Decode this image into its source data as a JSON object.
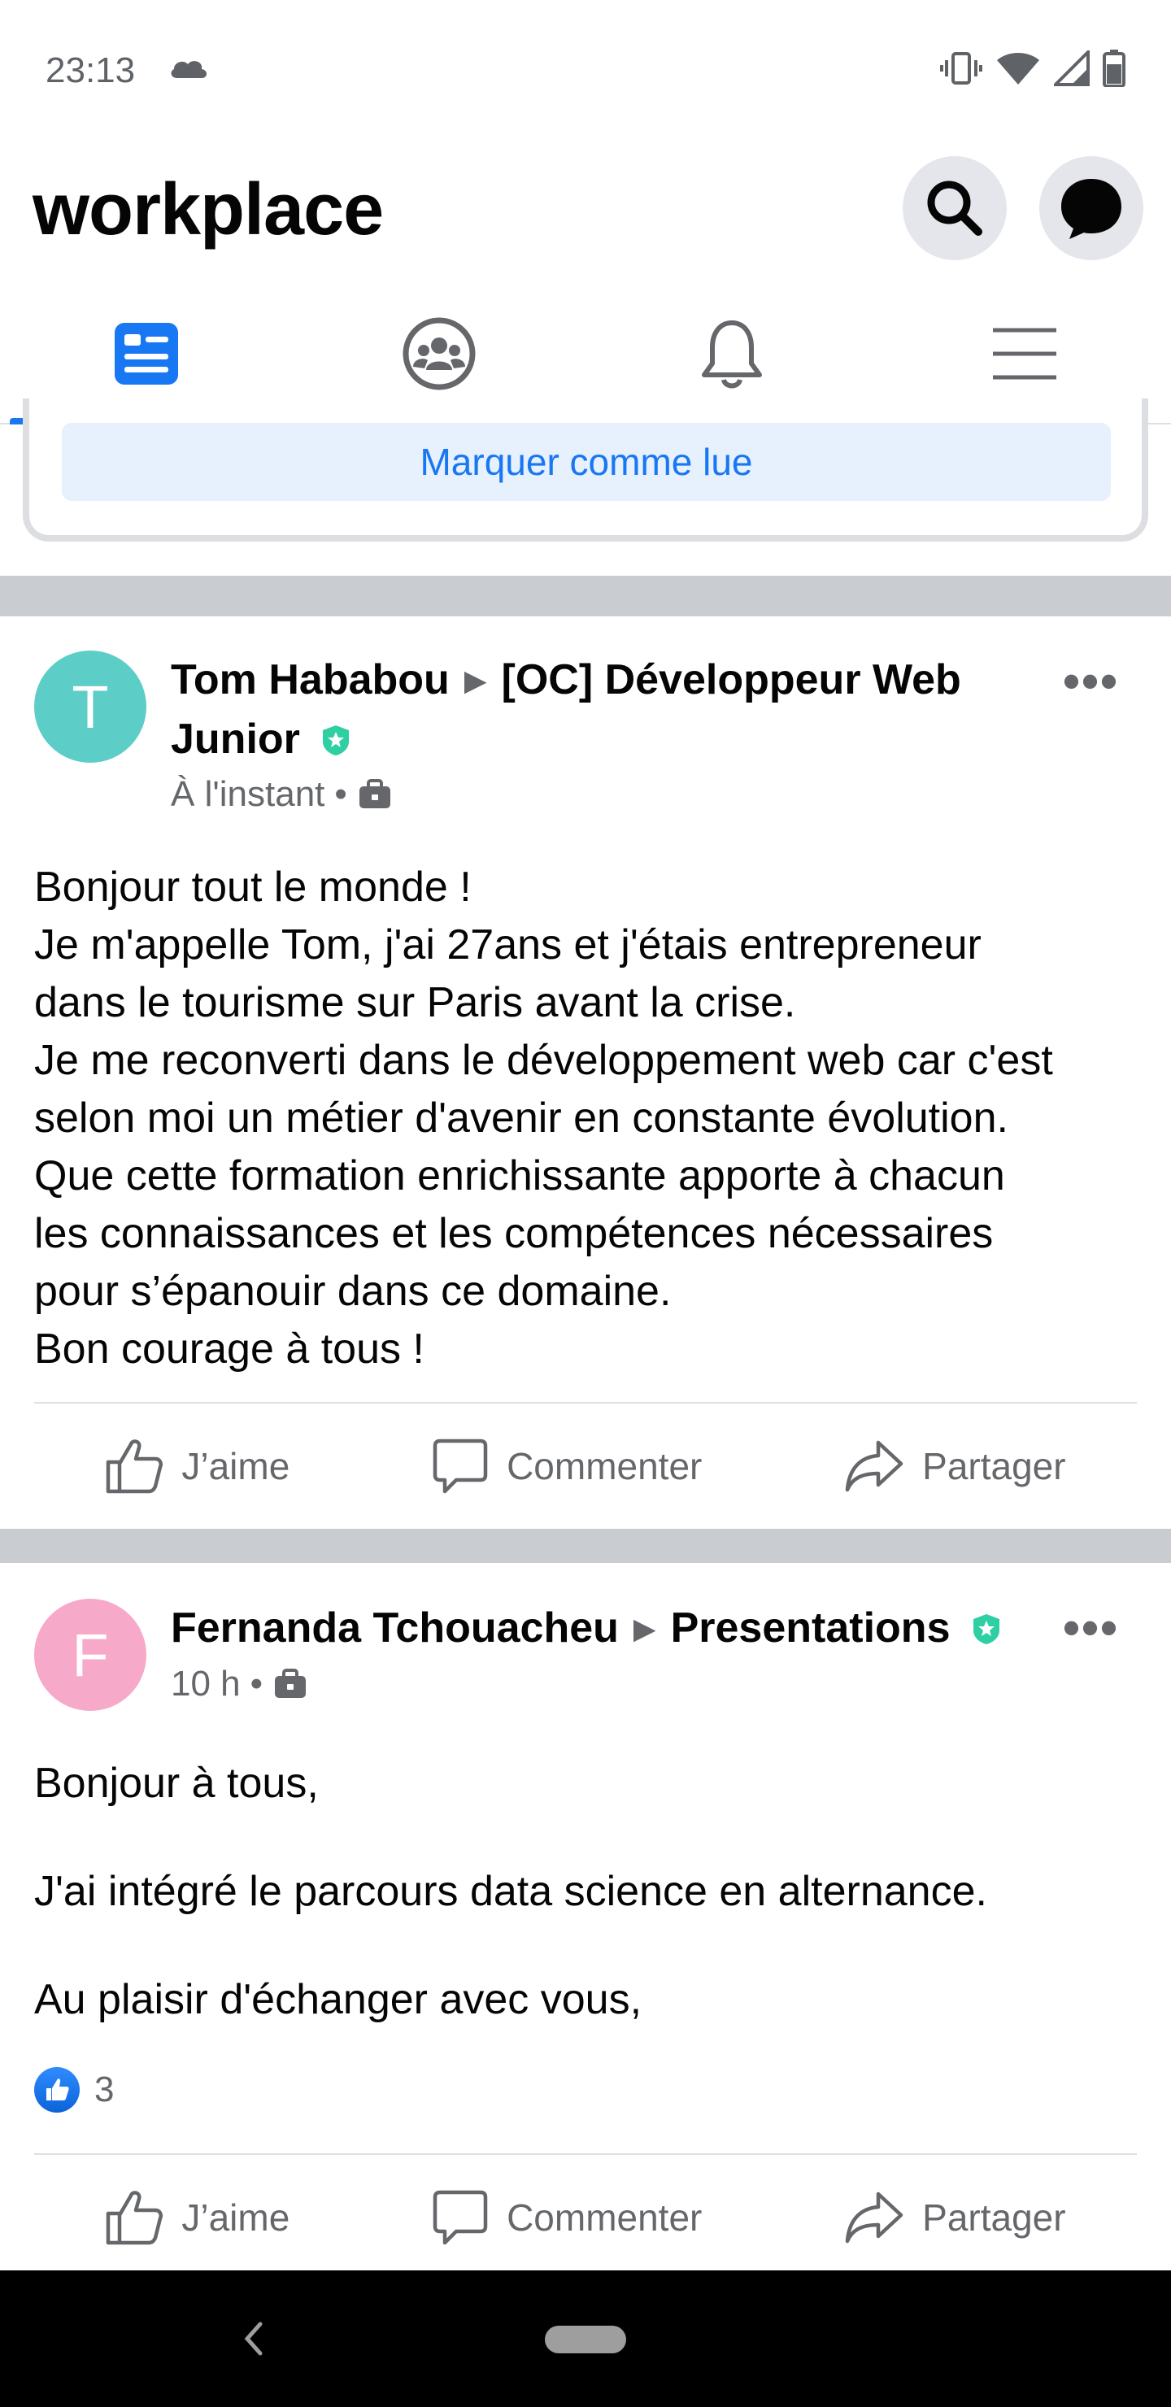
{
  "status_bar": {
    "time": "23:13"
  },
  "header": {
    "logo_text": "workplace"
  },
  "tabs": [
    {
      "name": "news-feed",
      "active": true
    },
    {
      "name": "groups",
      "active": false
    },
    {
      "name": "notifications",
      "active": false
    },
    {
      "name": "menu",
      "active": false
    }
  ],
  "top_card": {
    "mark_read_label": "Marquer comme lue"
  },
  "posts": [
    {
      "avatar_letter": "T",
      "avatar_color": "#5dcdc8",
      "author": "Tom Hababou",
      "group_line1": "[OC] Développeur Web",
      "group_line2": "Junior",
      "time": "À l'instant",
      "body": "Bonjour tout le monde !\nJe m'appelle Tom, j'ai 27ans et j'étais entrepreneur\ndans le tourisme sur Paris avant la crise.\nJe me reconverti dans le développement web car c'est\nselon moi un métier d'avenir en constante évolution.\nQue cette formation enrichissante apporte à chacun\nles connaissances et les compétences nécessaires\npour s’épanouir dans ce domaine.\nBon courage à tous !",
      "actions": {
        "like": "J’aime",
        "comment": "Commenter",
        "share": "Partager"
      }
    },
    {
      "avatar_letter": "F",
      "avatar_color": "#f7a9c9",
      "author": "Fernanda Tchouacheu",
      "group": "Presentations",
      "time": "10 h",
      "body_paragraphs": [
        "Bonjour à tous,",
        "J'ai intégré le parcours data science en alternance.",
        "Au plaisir d'échanger avec vous,"
      ],
      "reaction_count": "3",
      "actions": {
        "like": "J’aime",
        "comment": "Commenter",
        "share": "Partager"
      }
    }
  ],
  "colors": {
    "accent": "#1877f2",
    "badge": "#2fcfa4",
    "separator": "#c9ccd1"
  }
}
